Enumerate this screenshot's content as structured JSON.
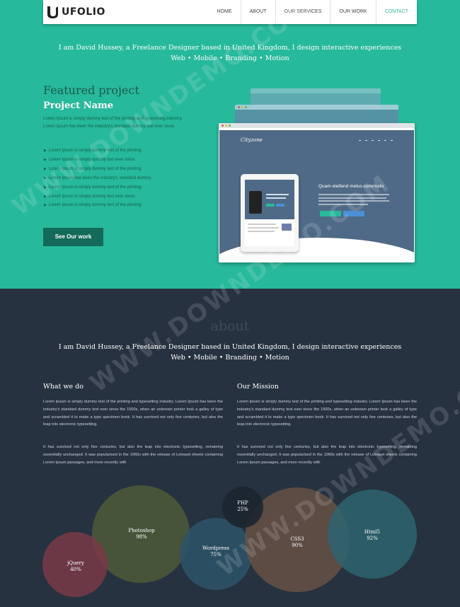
{
  "brand": {
    "logo_text": "UFOLIO"
  },
  "nav": {
    "items": [
      "HOME",
      "ABOUT",
      "OUR SERVICES",
      "OUR WORK",
      "CONTACT"
    ],
    "active_index": 4
  },
  "hero": {
    "tagline": "I am David Hussey, a Freelance Designer based in United Kingdom, I design interactive experiences",
    "skills": "Web • Mobile • Branding • Motion",
    "featured_title": "Featured project",
    "project_name": "Project Name",
    "project_desc": "Lorem Ipsum is simply dummy text of the printing and typesetting industry. Lorem Ipsum has been the industry's standard dummy text ever since.",
    "bullets": [
      "Lorem Ipsum is simply dummy text of the printing.",
      "Lorem Ipsum is simply dummy text ever since.",
      "Lorem Ipsum is simply dummy text of the printing.",
      "Lorem Ipsum has been the industry's standard dummy.",
      "Lorem Ipsum is simply dummy text of the printing.",
      "Lorem Ipsum is simply dummy text ever since.",
      "Lorem Ipsum is simply dummy text of the printing."
    ],
    "cta_label": "See Our work",
    "mockup": {
      "brand": "Cityzone",
      "heading": "Quam eleifend metus commodo"
    }
  },
  "about": {
    "label": "about",
    "tagline": "I am David Hussey, a Freelance Designer based in United Kingdom, I design interactive experiences",
    "skills": "Web • Mobile • Branding • Motion",
    "what_we_do": {
      "title": "What we do",
      "p1": "Lorem Ipsum is simply dummy text of the printing and typesetting industry. Lorem Ipsum has been the industry's standard dummy text ever since the 1500s, when an unknown printer took a galley of type and scrambled it to make a type specimen book. It has survived not only five centuries, but also the leap into electronic typesetting.",
      "p2": "It has survived not only five centuries, but also the leap into electronic typesetting, remaining essentially unchanged. It was popularised in the 1960s with the release of Letraset sheets containing Lorem Ipsum passages, and more recently with"
    },
    "our_mission": {
      "title": "Our Mission",
      "p1": "Lorem Ipsum is simply dummy text of the printing and typesetting industry. Lorem Ipsum has been the industry's standard dummy text ever since the 1500s, when an unknown printer took a galley of type and scrambled it to make a type specimen book. It has survived not only five centuries, but also the leap into electronic typesetting.",
      "p2": "It has survived not only five centuries, but also the leap into electronic typesetting, remaining essentially unchanged. It was popularised in the 1960s with the release of Letraset sheets containing Lorem Ipsum passages, and more recently with"
    }
  },
  "skills_bubbles": [
    {
      "name": "jQuery",
      "percent": "40%",
      "color": "#7a3a48"
    },
    {
      "name": "Photoshop",
      "percent": "98%",
      "color": "#4e5a3a"
    },
    {
      "name": "Wordpress",
      "percent": "75%",
      "color": "#2e5468"
    },
    {
      "name": "PHP",
      "percent": "25%",
      "color": "#1b2530"
    },
    {
      "name": "CSS3",
      "percent": "90%",
      "color": "#6a5246"
    },
    {
      "name": "Html5",
      "percent": "92%",
      "color": "#2d6470"
    }
  ],
  "watermark": "WWW.DOWNDEMO.COM"
}
